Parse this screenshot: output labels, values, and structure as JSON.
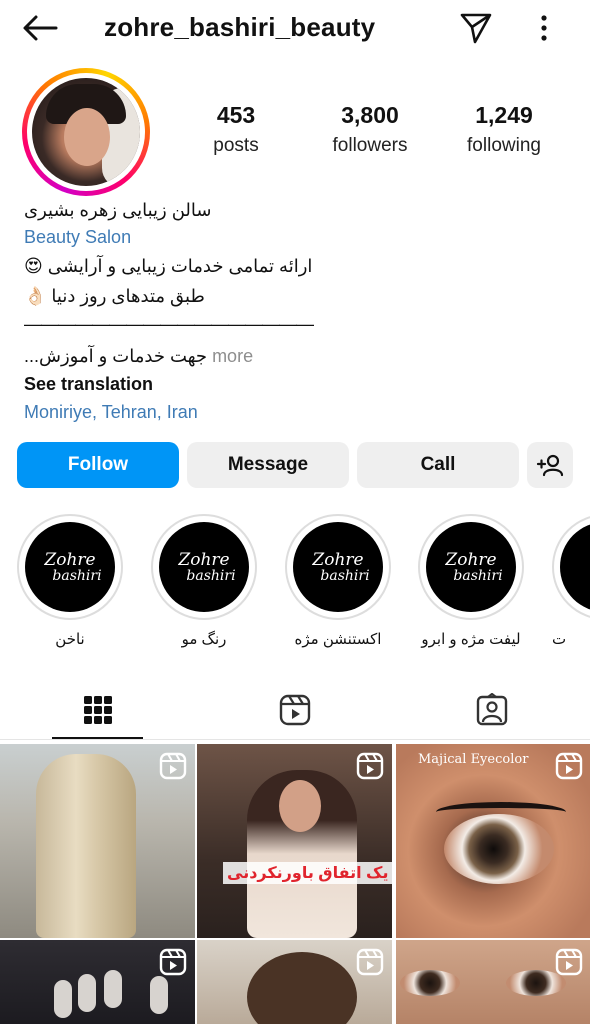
{
  "header": {
    "username": "zohre_bashiri_beauty"
  },
  "stats": {
    "posts": {
      "value": "453",
      "label": "posts"
    },
    "followers": {
      "value": "3,800",
      "label": "followers"
    },
    "following": {
      "value": "1,249",
      "label": "following"
    }
  },
  "bio": {
    "name": "سالن زیبایی زهره بشیری",
    "category": "Beauty Salon",
    "line1": "ارائه تمامی خدمات زیبایی و آرایشی 😍",
    "line2": "طبق متدهای روز دنیا 👌🏻",
    "divider": "—————————————————",
    "line4_text": "جهت خدمات و آموزش...",
    "line4_more": " more",
    "see_translation": "See translation",
    "location": "Moniriye, Tehran, Iran"
  },
  "buttons": {
    "follow": "Follow",
    "message": "Message",
    "call": "Call"
  },
  "highlights": [
    {
      "label": "ناخن",
      "logo_line1": "Zohre",
      "logo_line2": "bashiri"
    },
    {
      "label": "رنگ مو",
      "logo_line1": "Zohre",
      "logo_line2": "bashiri"
    },
    {
      "label": "اکستنشن مژه",
      "logo_line1": "Zohre",
      "logo_line2": "bashiri"
    },
    {
      "label": "لیفت مژه و ابرو",
      "logo_line1": "Zohre",
      "logo_line2": "bashiri"
    },
    {
      "label": "ت",
      "logo_line1": "Z",
      "logo_line2": ""
    }
  ],
  "tabs": [
    "posts-grid",
    "reels",
    "tagged"
  ],
  "posts": {
    "p2_caption": "یک اتفاق باورنکردنی",
    "p3_brand": "Majical Eyecolor"
  },
  "icons": {
    "back": "arrow-left-icon",
    "send": "paper-plane-icon",
    "more": "kebab-menu-icon",
    "add_user": "add-user-icon",
    "grid": "grid-icon",
    "reels": "reels-icon",
    "tagged": "tagged-person-icon"
  },
  "colors": {
    "accent": "#0095f6",
    "link": "#3f7bb5"
  }
}
